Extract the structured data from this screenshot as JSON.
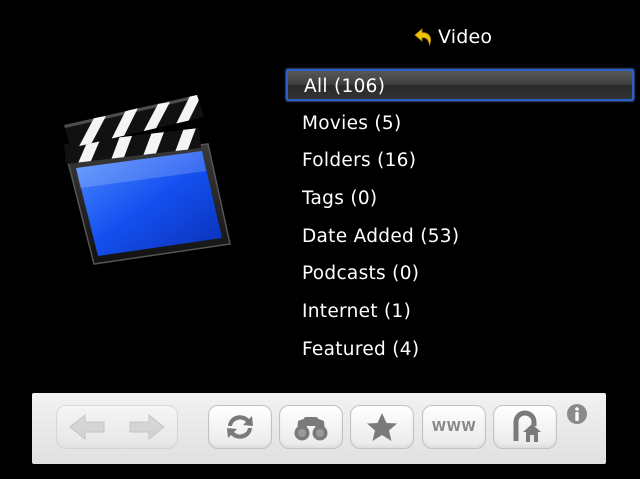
{
  "header": {
    "title": "Video",
    "back_icon": "back-arrow-icon"
  },
  "menu": {
    "selected_index": 0,
    "items": [
      {
        "label": "All (106)"
      },
      {
        "label": "Movies (5)"
      },
      {
        "label": "Folders (16)"
      },
      {
        "label": "Tags (0)"
      },
      {
        "label": "Date Added (53)"
      },
      {
        "label": "Podcasts (0)"
      },
      {
        "label": "Internet (1)"
      },
      {
        "label": "Featured (4)"
      }
    ]
  },
  "toolbar": {
    "buttons": [
      {
        "icon": "back-arrow-icon",
        "enabled": false
      },
      {
        "icon": "forward-arrow-icon",
        "enabled": false
      },
      {
        "icon": "refresh-icon",
        "enabled": true
      },
      {
        "icon": "binoculars-icon",
        "enabled": true
      },
      {
        "icon": "star-icon",
        "enabled": true
      },
      {
        "icon": "www-icon",
        "label": "WWW",
        "enabled": true
      },
      {
        "icon": "home-icon",
        "enabled": true
      },
      {
        "icon": "info-icon",
        "enabled": true
      }
    ]
  },
  "colors": {
    "background": "#000000",
    "selection_border": "#2a5fc8",
    "accent_yellow": "#f2c200"
  }
}
